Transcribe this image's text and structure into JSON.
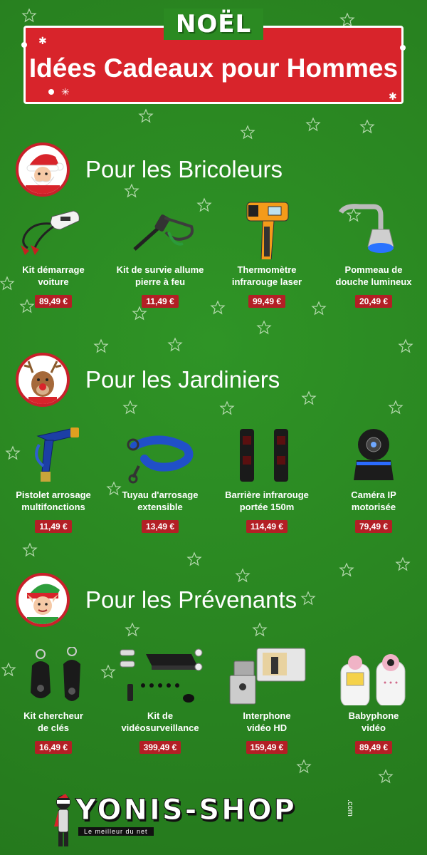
{
  "banner": {
    "noel": "NOËL",
    "title": "Idées Cadeaux pour Hommes"
  },
  "sections": [
    {
      "title": "Pour les Bricoleurs",
      "avatar_icon": "santa-icon",
      "items": [
        {
          "name_l1": "Kit démarrage",
          "name_l2": "voiture",
          "price": "89,49 €",
          "icon": "jump-starter-icon"
        },
        {
          "name_l1": "Kit de survie allume",
          "name_l2": "pierre à feu",
          "price": "11,49 €",
          "icon": "fire-starter-icon"
        },
        {
          "name_l1": "Thermomètre",
          "name_l2": "infrarouge laser",
          "price": "99,49 €",
          "icon": "thermometer-gun-icon"
        },
        {
          "name_l1": "Pommeau de",
          "name_l2": "douche lumineux",
          "price": "20,49 €",
          "icon": "shower-head-icon"
        }
      ]
    },
    {
      "title": "Pour les Jardiniers",
      "avatar_icon": "reindeer-icon",
      "items": [
        {
          "name_l1": "Pistolet arrosage",
          "name_l2": "multifonctions",
          "price": "11,49 €",
          "icon": "spray-gun-icon"
        },
        {
          "name_l1": "Tuyau d'arrosage",
          "name_l2": "extensible",
          "price": "13,49 €",
          "icon": "garden-hose-icon"
        },
        {
          "name_l1": "Barrière infrarouge",
          "name_l2": "portée 150m",
          "price": "114,49 €",
          "icon": "infrared-barrier-icon"
        },
        {
          "name_l1": "Caméra IP",
          "name_l2": "motorisée",
          "price": "79,49 €",
          "icon": "ip-camera-icon"
        }
      ]
    },
    {
      "title": "Pour les Prévenants",
      "avatar_icon": "elf-icon",
      "items": [
        {
          "name_l1": "Kit chercheur",
          "name_l2": "de clés",
          "price": "16,49 €",
          "icon": "key-finder-icon"
        },
        {
          "name_l1": "Kit de",
          "name_l2": "vidéosurveillance",
          "price": "399,49 €",
          "icon": "cctv-kit-icon"
        },
        {
          "name_l1": "Interphone",
          "name_l2": "vidéo HD",
          "price": "159,49 €",
          "icon": "video-intercom-icon"
        },
        {
          "name_l1": "Babyphone",
          "name_l2": "vidéo",
          "price": "89,49 €",
          "icon": "baby-monitor-icon"
        }
      ]
    }
  ],
  "logo": {
    "text": "YONIS-SHOP",
    "tagline": "Le meilleur du net",
    "suffix": ".com"
  },
  "colors": {
    "background": "#2b8a22",
    "banner_red": "#d8242b",
    "price_red": "#b31f25"
  }
}
